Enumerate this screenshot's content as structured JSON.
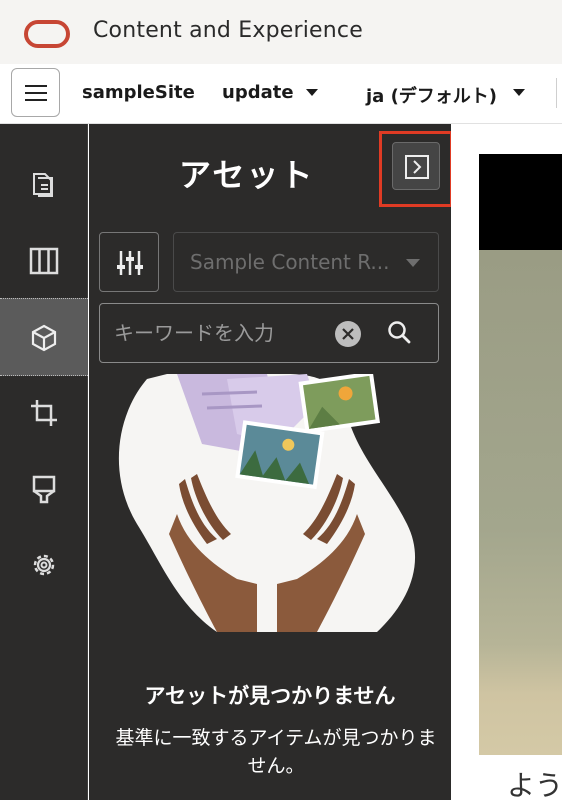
{
  "app": {
    "title": "Content and Experience"
  },
  "toolbar": {
    "site": "sampleSite",
    "update": "update",
    "language": "ja (デフォルト)"
  },
  "rail": {
    "items": [
      {
        "icon": "pages-icon",
        "active": false
      },
      {
        "icon": "layout-columns-icon",
        "active": false
      },
      {
        "icon": "assets-cube-icon",
        "active": true
      },
      {
        "icon": "crop-icon",
        "active": false
      },
      {
        "icon": "theme-brush-icon",
        "active": false
      },
      {
        "icon": "settings-gear-icon",
        "active": false
      }
    ]
  },
  "panel": {
    "title": "アセット",
    "repository": "Sample Content R...",
    "search_placeholder": "キーワードを入力",
    "empty_title": "アセットが見つかりません",
    "empty_description": "基準に一致するアイテムが見つかりません。"
  },
  "preview": {
    "text": "よう"
  },
  "colors": {
    "accent_red": "#e03b24",
    "oracle_red": "#c74634",
    "panel_bg": "#2c2b2a"
  }
}
